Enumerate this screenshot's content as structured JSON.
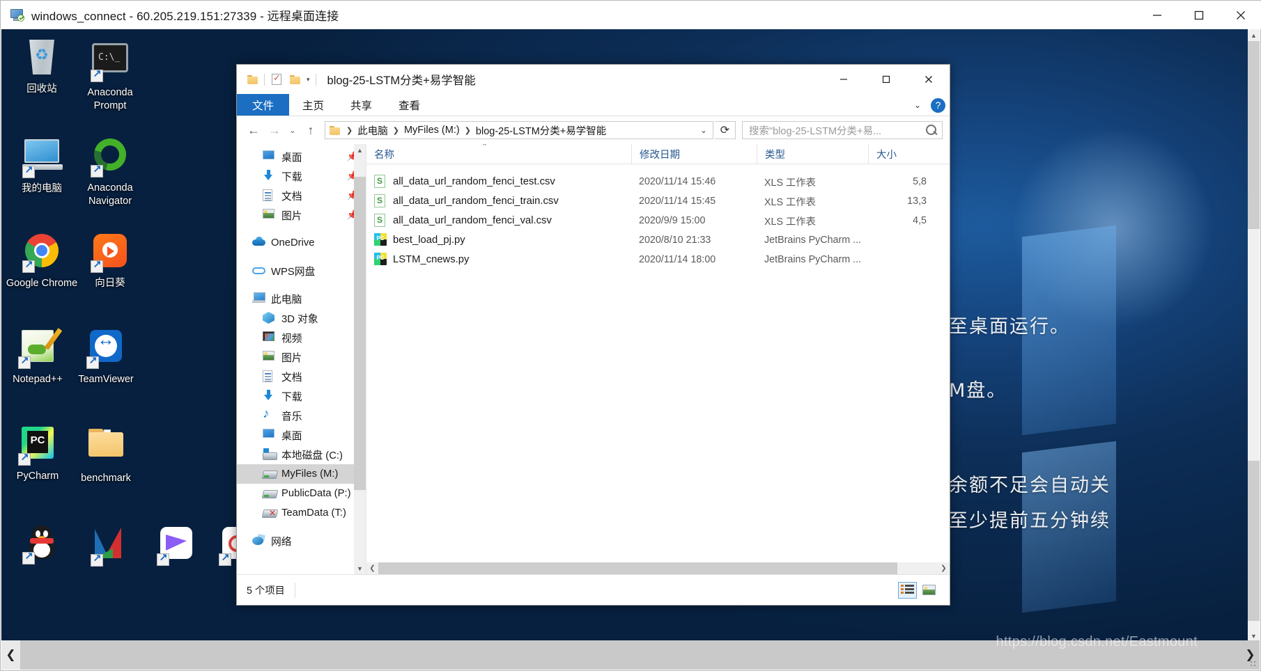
{
  "rdp_window": {
    "title": "windows_connect - 60.205.219.151:27339 - 远程桌面连接",
    "icon": "remote-desktop-icon",
    "buttons": {
      "minimize": "最小化",
      "maximize": "最大化",
      "close": "关闭"
    }
  },
  "desktop": {
    "wallpaper_text": [
      "至桌面运行。",
      "M盘。",
      "余额不足会自动关",
      "至少提前五分钟续"
    ],
    "icons": [
      {
        "label": "回收站",
        "icon": "recycle-bin-icon",
        "shortcut": false,
        "col": 0,
        "row": 0
      },
      {
        "label": "Anaconda Prompt",
        "icon": "anaconda-prompt-icon",
        "shortcut": true,
        "col": 1,
        "row": 0
      },
      {
        "label": "我的电脑",
        "icon": "my-computer-icon",
        "shortcut": true,
        "col": 0,
        "row": 1
      },
      {
        "label": "Anaconda Navigator",
        "icon": "anaconda-navigator-icon",
        "shortcut": true,
        "col": 1,
        "row": 1
      },
      {
        "label": "Google Chrome",
        "icon": "google-chrome-icon",
        "shortcut": true,
        "col": 0,
        "row": 2
      },
      {
        "label": "向日葵",
        "icon": "sunlogin-icon",
        "shortcut": true,
        "col": 1,
        "row": 2
      },
      {
        "label": "Notepad++",
        "icon": "notepad-plus-plus-icon",
        "shortcut": true,
        "col": 0,
        "row": 3
      },
      {
        "label": "TeamViewer",
        "icon": "teamviewer-icon",
        "shortcut": true,
        "col": 1,
        "row": 3
      },
      {
        "label": "PyCharm",
        "icon": "pycharm-icon",
        "shortcut": true,
        "col": 0,
        "row": 4
      },
      {
        "label": "benchmark",
        "icon": "folder-icon",
        "shortcut": false,
        "col": 1,
        "row": 4
      },
      {
        "label": "",
        "icon": "qq-icon",
        "shortcut": true,
        "col": 0,
        "row": 5
      },
      {
        "label": "",
        "icon": "triangles-app-icon",
        "shortcut": true,
        "col": 1,
        "row": 5
      },
      {
        "label": "",
        "icon": "bird-app-icon",
        "shortcut": true,
        "col": 2,
        "row": 5
      },
      {
        "label": "",
        "icon": "rings-app-icon",
        "shortcut": true,
        "col": 3,
        "row": 5
      }
    ]
  },
  "explorer": {
    "title": "blog-25-LSTM分类+易学智能",
    "quick_access": [
      {
        "name": "folder-icon"
      },
      {
        "name": "properties-icon"
      },
      {
        "name": "new-folder-icon"
      },
      {
        "name": "customize-caret-icon"
      }
    ],
    "window_buttons": {
      "minimize": "最小化",
      "maximize": "最大化",
      "close": "关闭"
    },
    "ribbon": {
      "tabs": [
        {
          "label": "文件",
          "active": true
        },
        {
          "label": "主页",
          "active": false
        },
        {
          "label": "共享",
          "active": false
        },
        {
          "label": "查看",
          "active": false
        }
      ],
      "expand_icon": "chevron-down-icon",
      "help_label": "?"
    },
    "address": {
      "back_icon": "arrow-left-icon",
      "forward_icon": "arrow-right-icon",
      "recent_icon": "chevron-down-icon",
      "up_icon": "arrow-up-icon",
      "breadcrumbs": [
        "此电脑",
        "MyFiles (M:)",
        "blog-25-LSTM分类+易学智能"
      ],
      "dropdown_icon": "chevron-down-icon",
      "refresh_icon": "refresh-icon"
    },
    "search": {
      "placeholder": "搜索\"blog-25-LSTM分类+易...",
      "icon": "search-icon"
    },
    "nav_pane": {
      "items": [
        {
          "label": "桌面",
          "icon": "desktop-icon",
          "level": 2,
          "pinned": true,
          "selected": false
        },
        {
          "label": "下载",
          "icon": "download-icon",
          "level": 2,
          "pinned": true,
          "selected": false
        },
        {
          "label": "文档",
          "icon": "documents-icon",
          "level": 2,
          "pinned": true,
          "selected": false
        },
        {
          "label": "图片",
          "icon": "pictures-icon",
          "level": 2,
          "pinned": true,
          "selected": false
        },
        {
          "label": "OneDrive",
          "icon": "onedrive-icon",
          "level": 1,
          "pinned": false,
          "selected": false,
          "gap_before": true
        },
        {
          "label": "WPS网盘",
          "icon": "wps-cloud-icon",
          "level": 1,
          "pinned": false,
          "selected": false,
          "gap_before": true
        },
        {
          "label": "此电脑",
          "icon": "this-pc-icon",
          "level": 1,
          "pinned": false,
          "selected": false,
          "gap_before": true
        },
        {
          "label": "3D 对象",
          "icon": "3d-objects-icon",
          "level": 2,
          "pinned": false,
          "selected": false
        },
        {
          "label": "视频",
          "icon": "videos-icon",
          "level": 2,
          "pinned": false,
          "selected": false
        },
        {
          "label": "图片",
          "icon": "pictures-icon",
          "level": 2,
          "pinned": false,
          "selected": false
        },
        {
          "label": "文档",
          "icon": "documents-icon",
          "level": 2,
          "pinned": false,
          "selected": false
        },
        {
          "label": "下载",
          "icon": "download-icon",
          "level": 2,
          "pinned": false,
          "selected": false
        },
        {
          "label": "音乐",
          "icon": "music-icon",
          "level": 2,
          "pinned": false,
          "selected": false
        },
        {
          "label": "桌面",
          "icon": "desktop-icon",
          "level": 2,
          "pinned": false,
          "selected": false
        },
        {
          "label": "本地磁盘 (C:)",
          "icon": "local-disk-icon",
          "level": 2,
          "pinned": false,
          "selected": false
        },
        {
          "label": "MyFiles (M:)",
          "icon": "network-drive-icon",
          "level": 2,
          "pinned": false,
          "selected": true
        },
        {
          "label": "PublicData (P:)",
          "icon": "network-drive-icon",
          "level": 2,
          "pinned": false,
          "selected": false
        },
        {
          "label": "TeamData (T:)",
          "icon": "network-drive-disconnected-icon",
          "level": 2,
          "pinned": false,
          "selected": false
        },
        {
          "label": "网络",
          "icon": "network-icon",
          "level": 1,
          "pinned": false,
          "selected": false,
          "gap_before": true
        }
      ]
    },
    "columns": [
      {
        "key": "name",
        "label": "名称"
      },
      {
        "key": "date",
        "label": "修改日期"
      },
      {
        "key": "type",
        "label": "类型"
      },
      {
        "key": "size",
        "label": "大小"
      }
    ],
    "sort_indicator": "ascending-caret-icon",
    "files": [
      {
        "name": "all_data_url_random_fenci_test.csv",
        "date": "2020/11/14 15:46",
        "type": "XLS 工作表",
        "size": "5,8",
        "icon": "csv-file-icon"
      },
      {
        "name": "all_data_url_random_fenci_train.csv",
        "date": "2020/11/14 15:45",
        "type": "XLS 工作表",
        "size": "13,3",
        "icon": "csv-file-icon"
      },
      {
        "name": "all_data_url_random_fenci_val.csv",
        "date": "2020/9/9 15:00",
        "type": "XLS 工作表",
        "size": "4,5",
        "icon": "csv-file-icon"
      },
      {
        "name": "best_load_pj.py",
        "date": "2020/8/10 21:33",
        "type": "JetBrains PyCharm ...",
        "size": "",
        "icon": "python-file-icon"
      },
      {
        "name": "LSTM_cnews.py",
        "date": "2020/11/14 18:00",
        "type": "JetBrains PyCharm ...",
        "size": "",
        "icon": "python-file-icon"
      }
    ],
    "status": {
      "item_count": "5 个项目"
    },
    "view_buttons": [
      {
        "name": "details-view-button",
        "selected": true
      },
      {
        "name": "thumbnails-view-button",
        "selected": false
      }
    ]
  },
  "watermark": "https://blog.csdn.net/Eastmount",
  "colors": {
    "ribbon_file_tab": "#1b6ec2",
    "column_header_text": "#27588f",
    "selection": "#d4d4d4",
    "taskbar": "#c9c9c9"
  }
}
